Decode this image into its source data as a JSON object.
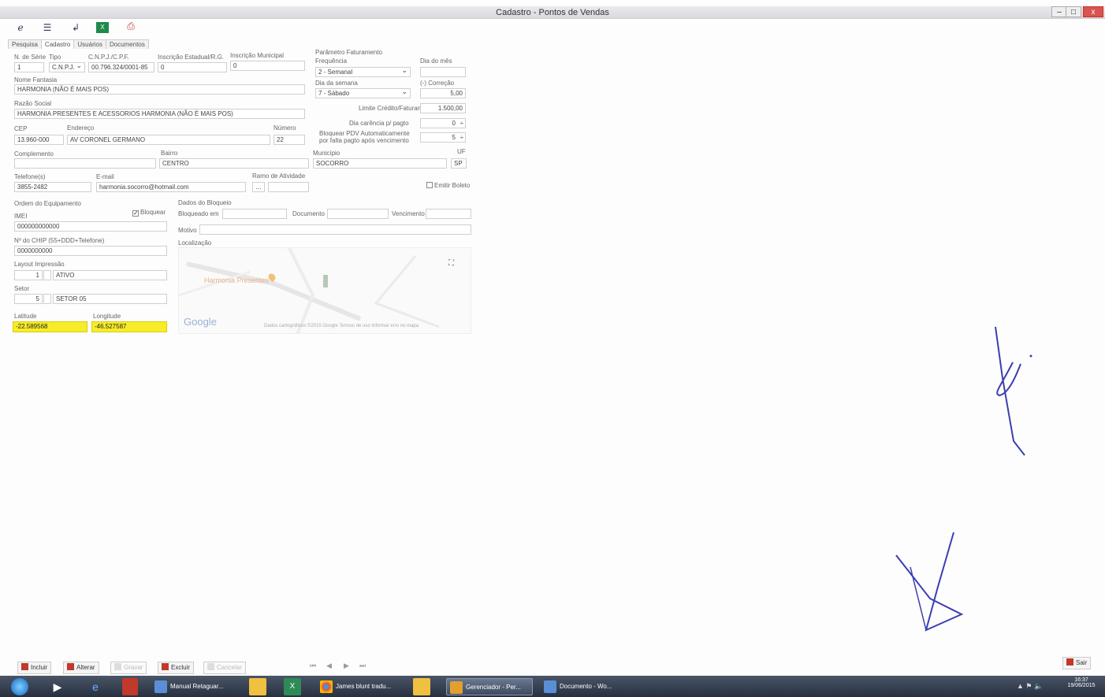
{
  "window": {
    "title": "Cadastro - Pontos de Vendas",
    "minimize": "–",
    "maximize": "□",
    "close": "x"
  },
  "toolbar": {
    "icons": [
      "refresh-icon",
      "list-icon",
      "undo-icon",
      "excel-icon",
      "print-icon"
    ]
  },
  "tabs": [
    "Pesquisa",
    "Cadastro",
    "Usuários",
    "Documentos"
  ],
  "form": {
    "serie_label": "N. de Série",
    "serie_value": "1",
    "tipo_label": "Tipo",
    "tipo_value": "C.N.P.J.",
    "cnpj_label": "C.N.P.J./C.P.F.",
    "cnpj_value": "00.796.324/0001-85",
    "ie_label": "Inscrição Estadual/R.G.",
    "ie_value": "0",
    "im_label": "Inscrição Municipal",
    "im_value": "0",
    "fantasia_label": "Nome Fantasia",
    "fantasia_value": "HARMONIA (NÃO É MAIS POS)",
    "razao_label": "Razão Social",
    "razao_value": "HARMONIA PRESENTES E ACESSORIOS HARMONIA (NÃO É MAIS POS)",
    "cep_label": "CEP",
    "cep_value": "13.960-000",
    "endereco_label": "Endereço",
    "endereco_value": "AV CORONEL GERMANO",
    "numero_label": "Número",
    "numero_value": "22",
    "complemento_label": "Complemento",
    "complemento_value": "",
    "bairro_label": "Bairro",
    "bairro_value": "CENTRO",
    "municipio_label": "Município",
    "municipio_value": "SOCORRO",
    "uf_label": "UF",
    "uf_value": "SP",
    "telefone_label": "Telefone(s)",
    "telefone_value": "3855-2482",
    "email_label": "E-mail",
    "email_value": "harmonia.socorro@hotmail.com",
    "ramo_label": "Ramo de Atividade",
    "emitir_boleto_label": "Emitir Boleto"
  },
  "faturamento": {
    "section_label": "Parâmetro Faturamento",
    "frequencia_label": "Frequência",
    "frequencia_value": "2 - Semanal",
    "dia_mes_label": "Dia do mês",
    "dia_mes_value": "",
    "dia_semana_label": "Dia da semana",
    "dia_semana_value": "7 - Sábado",
    "correcao_label": "(-) Correção",
    "correcao_value": "5,00",
    "limite_label": "Limite Crédito/Faturamento",
    "limite_value": "1.500,00",
    "carencia_label": "Dia carência p/ pagto",
    "carencia_value": "0",
    "bloquear_label_1": "Bloquear PDV Automaticamente",
    "bloquear_label_2": "por falta pagto após vencimento",
    "bloquear_value": "5"
  },
  "equipamento": {
    "ordem_label": "Ordem do Equipamento",
    "bloquear_check": "Bloquear",
    "imei_label": "IMEI",
    "imei_value": "000000000000",
    "chip_label": "Nº do CHIP (55+DDD+Telefone)",
    "chip_value": "0000000000",
    "layout_label": "Layout Impressão",
    "layout_num": "1",
    "layout_value": "ATIVO",
    "setor_label": "Setor",
    "setor_num": "5",
    "setor_value": "SETOR 05",
    "latitude_label": "Latitude",
    "latitude_value": "-22.589568",
    "longitude_label": "Longitude",
    "longitude_value": "-46.527587"
  },
  "bloqueio": {
    "section_label": "Dados do Bloqueio",
    "bloqueado_label": "Bloqueado em",
    "documento_label": "Documento",
    "vencimento_label": "Vencimento",
    "motivo_label": "Motivo",
    "localizacao_label": "Localização",
    "map_place": "Harmonia Presentes",
    "map_brand": "Google",
    "map_footer": "Dados cartográficos ©2015 Google   Termos de uso   Informar erro no mapa"
  },
  "bottom_bar": {
    "incluir": "Incluir",
    "alterar": "Alterar",
    "gravar": "Gravar",
    "excluir": "Excluir",
    "cancelar": "Cancelar",
    "sair": "Sair"
  },
  "taskbar": {
    "items": [
      "Manual Retaguar...",
      "James blunt tradu...",
      "Gerenciador - Per...",
      "Documento - Wo..."
    ],
    "time": "16:37",
    "date": "19/06/2015"
  },
  "colors": {
    "yellow_field": "#f7ec2a",
    "taskbar": "#263041",
    "signature_ink": "#3a3fb0"
  }
}
